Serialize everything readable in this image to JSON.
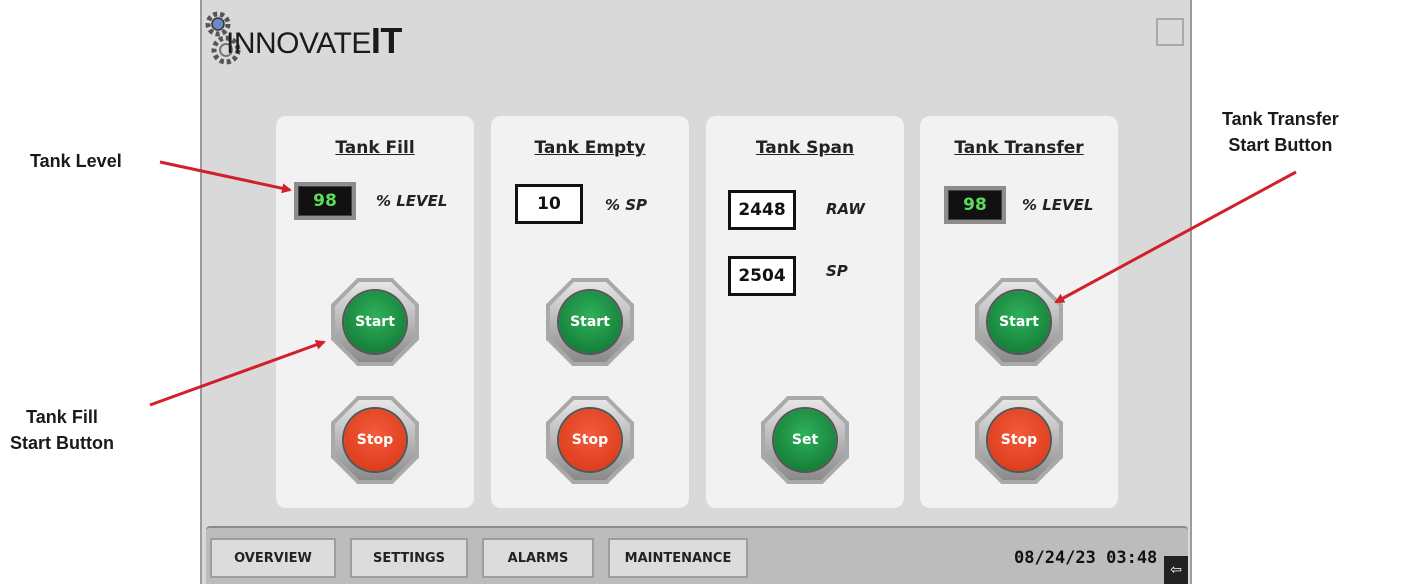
{
  "logo": {
    "text_a": "INNOVATE",
    "text_b": "IT"
  },
  "panels": [
    {
      "title": "Tank Fill",
      "level": "98",
      "level_unit": "% LEVEL",
      "start": "Start",
      "stop": "Stop"
    },
    {
      "title": "Tank Empty",
      "setpoint": "10",
      "setpoint_unit": "% SP",
      "start": "Start",
      "stop": "Stop"
    },
    {
      "title": "Tank Span",
      "raw": "2448",
      "raw_unit": "RAW",
      "sp": "2504",
      "sp_unit": "SP",
      "set": "Set"
    },
    {
      "title": "Tank Transfer",
      "level": "98",
      "level_unit": "% LEVEL",
      "start": "Start",
      "stop": "Stop"
    }
  ],
  "navbar": {
    "items": [
      "OVERVIEW",
      "SETTINGS",
      "ALARMS",
      "MAINTENANCE"
    ],
    "datetime": "08/24/23 03:48"
  },
  "callouts": {
    "tank_level": "Tank Level",
    "tank_fill_start": [
      "Tank Fill",
      "Start Button"
    ],
    "tank_transfer_start": [
      "Tank Transfer",
      "Start Button"
    ]
  },
  "colors": {
    "start": "#17843c",
    "stop": "#e0401f",
    "arrow": "#d0202a",
    "level_text": "#5bdc5b"
  },
  "icons": [
    "gear-icon",
    "back-arrow-icon"
  ]
}
